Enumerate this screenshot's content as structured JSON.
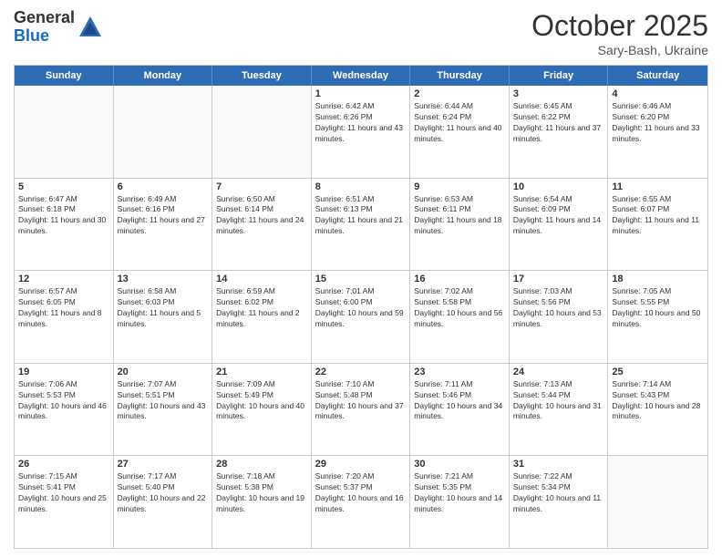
{
  "header": {
    "logo_general": "General",
    "logo_blue": "Blue",
    "month_year": "October 2025",
    "location": "Sary-Bash, Ukraine"
  },
  "calendar": {
    "days_of_week": [
      "Sunday",
      "Monday",
      "Tuesday",
      "Wednesday",
      "Thursday",
      "Friday",
      "Saturday"
    ],
    "weeks": [
      [
        {
          "day": "",
          "sunrise": "",
          "sunset": "",
          "daylight": ""
        },
        {
          "day": "",
          "sunrise": "",
          "sunset": "",
          "daylight": ""
        },
        {
          "day": "",
          "sunrise": "",
          "sunset": "",
          "daylight": ""
        },
        {
          "day": "1",
          "sunrise": "Sunrise: 6:42 AM",
          "sunset": "Sunset: 6:26 PM",
          "daylight": "Daylight: 11 hours and 43 minutes."
        },
        {
          "day": "2",
          "sunrise": "Sunrise: 6:44 AM",
          "sunset": "Sunset: 6:24 PM",
          "daylight": "Daylight: 11 hours and 40 minutes."
        },
        {
          "day": "3",
          "sunrise": "Sunrise: 6:45 AM",
          "sunset": "Sunset: 6:22 PM",
          "daylight": "Daylight: 11 hours and 37 minutes."
        },
        {
          "day": "4",
          "sunrise": "Sunrise: 6:46 AM",
          "sunset": "Sunset: 6:20 PM",
          "daylight": "Daylight: 11 hours and 33 minutes."
        }
      ],
      [
        {
          "day": "5",
          "sunrise": "Sunrise: 6:47 AM",
          "sunset": "Sunset: 6:18 PM",
          "daylight": "Daylight: 11 hours and 30 minutes."
        },
        {
          "day": "6",
          "sunrise": "Sunrise: 6:49 AM",
          "sunset": "Sunset: 6:16 PM",
          "daylight": "Daylight: 11 hours and 27 minutes."
        },
        {
          "day": "7",
          "sunrise": "Sunrise: 6:50 AM",
          "sunset": "Sunset: 6:14 PM",
          "daylight": "Daylight: 11 hours and 24 minutes."
        },
        {
          "day": "8",
          "sunrise": "Sunrise: 6:51 AM",
          "sunset": "Sunset: 6:13 PM",
          "daylight": "Daylight: 11 hours and 21 minutes."
        },
        {
          "day": "9",
          "sunrise": "Sunrise: 6:53 AM",
          "sunset": "Sunset: 6:11 PM",
          "daylight": "Daylight: 11 hours and 18 minutes."
        },
        {
          "day": "10",
          "sunrise": "Sunrise: 6:54 AM",
          "sunset": "Sunset: 6:09 PM",
          "daylight": "Daylight: 11 hours and 14 minutes."
        },
        {
          "day": "11",
          "sunrise": "Sunrise: 6:55 AM",
          "sunset": "Sunset: 6:07 PM",
          "daylight": "Daylight: 11 hours and 11 minutes."
        }
      ],
      [
        {
          "day": "12",
          "sunrise": "Sunrise: 6:57 AM",
          "sunset": "Sunset: 6:05 PM",
          "daylight": "Daylight: 11 hours and 8 minutes."
        },
        {
          "day": "13",
          "sunrise": "Sunrise: 6:58 AM",
          "sunset": "Sunset: 6:03 PM",
          "daylight": "Daylight: 11 hours and 5 minutes."
        },
        {
          "day": "14",
          "sunrise": "Sunrise: 6:59 AM",
          "sunset": "Sunset: 6:02 PM",
          "daylight": "Daylight: 11 hours and 2 minutes."
        },
        {
          "day": "15",
          "sunrise": "Sunrise: 7:01 AM",
          "sunset": "Sunset: 6:00 PM",
          "daylight": "Daylight: 10 hours and 59 minutes."
        },
        {
          "day": "16",
          "sunrise": "Sunrise: 7:02 AM",
          "sunset": "Sunset: 5:58 PM",
          "daylight": "Daylight: 10 hours and 56 minutes."
        },
        {
          "day": "17",
          "sunrise": "Sunrise: 7:03 AM",
          "sunset": "Sunset: 5:56 PM",
          "daylight": "Daylight: 10 hours and 53 minutes."
        },
        {
          "day": "18",
          "sunrise": "Sunrise: 7:05 AM",
          "sunset": "Sunset: 5:55 PM",
          "daylight": "Daylight: 10 hours and 50 minutes."
        }
      ],
      [
        {
          "day": "19",
          "sunrise": "Sunrise: 7:06 AM",
          "sunset": "Sunset: 5:53 PM",
          "daylight": "Daylight: 10 hours and 46 minutes."
        },
        {
          "day": "20",
          "sunrise": "Sunrise: 7:07 AM",
          "sunset": "Sunset: 5:51 PM",
          "daylight": "Daylight: 10 hours and 43 minutes."
        },
        {
          "day": "21",
          "sunrise": "Sunrise: 7:09 AM",
          "sunset": "Sunset: 5:49 PM",
          "daylight": "Daylight: 10 hours and 40 minutes."
        },
        {
          "day": "22",
          "sunrise": "Sunrise: 7:10 AM",
          "sunset": "Sunset: 5:48 PM",
          "daylight": "Daylight: 10 hours and 37 minutes."
        },
        {
          "day": "23",
          "sunrise": "Sunrise: 7:11 AM",
          "sunset": "Sunset: 5:46 PM",
          "daylight": "Daylight: 10 hours and 34 minutes."
        },
        {
          "day": "24",
          "sunrise": "Sunrise: 7:13 AM",
          "sunset": "Sunset: 5:44 PM",
          "daylight": "Daylight: 10 hours and 31 minutes."
        },
        {
          "day": "25",
          "sunrise": "Sunrise: 7:14 AM",
          "sunset": "Sunset: 5:43 PM",
          "daylight": "Daylight: 10 hours and 28 minutes."
        }
      ],
      [
        {
          "day": "26",
          "sunrise": "Sunrise: 7:15 AM",
          "sunset": "Sunset: 5:41 PM",
          "daylight": "Daylight: 10 hours and 25 minutes."
        },
        {
          "day": "27",
          "sunrise": "Sunrise: 7:17 AM",
          "sunset": "Sunset: 5:40 PM",
          "daylight": "Daylight: 10 hours and 22 minutes."
        },
        {
          "day": "28",
          "sunrise": "Sunrise: 7:18 AM",
          "sunset": "Sunset: 5:38 PM",
          "daylight": "Daylight: 10 hours and 19 minutes."
        },
        {
          "day": "29",
          "sunrise": "Sunrise: 7:20 AM",
          "sunset": "Sunset: 5:37 PM",
          "daylight": "Daylight: 10 hours and 16 minutes."
        },
        {
          "day": "30",
          "sunrise": "Sunrise: 7:21 AM",
          "sunset": "Sunset: 5:35 PM",
          "daylight": "Daylight: 10 hours and 14 minutes."
        },
        {
          "day": "31",
          "sunrise": "Sunrise: 7:22 AM",
          "sunset": "Sunset: 5:34 PM",
          "daylight": "Daylight: 10 hours and 11 minutes."
        },
        {
          "day": "",
          "sunrise": "",
          "sunset": "",
          "daylight": ""
        }
      ]
    ]
  }
}
